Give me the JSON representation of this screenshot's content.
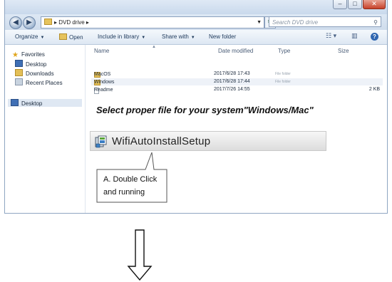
{
  "window": {
    "controls": {
      "minimize": "–",
      "maximize": "□",
      "close": "✕"
    }
  },
  "address": {
    "back_icon": "back-arrow-icon",
    "forward_icon": "forward-arrow-icon",
    "path_label": "DVD drive",
    "search_placeholder": "Search DVD drive"
  },
  "toolbar": {
    "organize": "Organize",
    "open": "Open",
    "include_in_library": "Include in library",
    "share_with": "Share with",
    "new_folder": "New folder"
  },
  "nav": {
    "favorites": "Favorites",
    "desktop": "Desktop",
    "downloads": "Downloads",
    "recent_places": "Recent Places",
    "desktop_root": "Desktop"
  },
  "columns": {
    "name": "Name",
    "date_modified": "Date modified",
    "type": "Type",
    "size": "Size"
  },
  "files": [
    {
      "name": "MacOS",
      "date": "2017/6/28 17:43",
      "type": "File folder",
      "size": "",
      "kind": "folder"
    },
    {
      "name": "Windows",
      "date": "2017/6/28 17:44",
      "type": "File folder",
      "size": "",
      "kind": "folder"
    },
    {
      "name": "Readme",
      "date": "2017/7/26 14:55",
      "type": "",
      "size": "2 KB",
      "kind": "document"
    }
  ],
  "instruction": "Select proper file for your system\"Windows/Mac\"",
  "setup": {
    "label": "WifiAutoInstallSetup"
  },
  "callout": {
    "line1": "A. Double Click",
    "line2": "and running"
  },
  "colors": {
    "accent": "#2f66b0",
    "titlebar": "#c9d9ec",
    "folder": "#e3bf57"
  }
}
